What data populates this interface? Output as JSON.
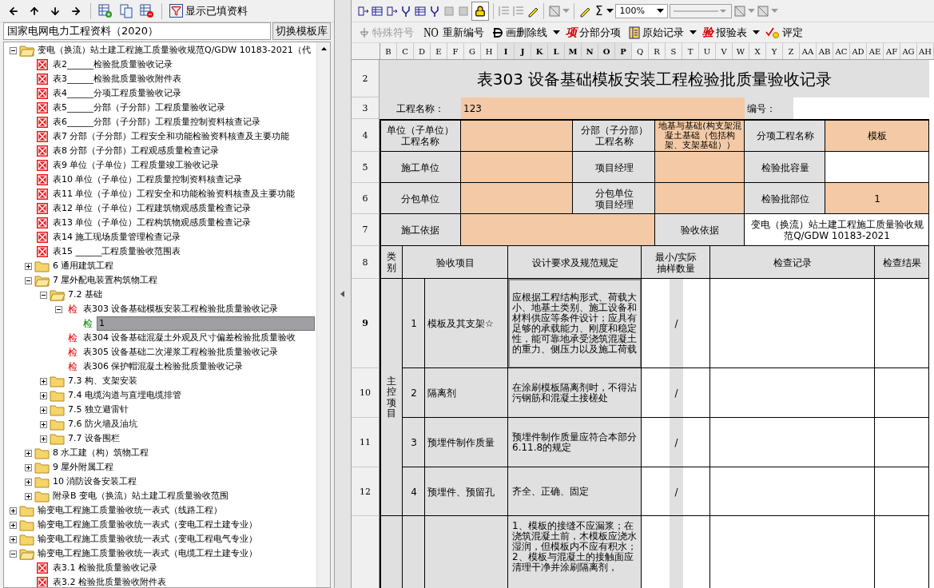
{
  "left_toolbar": {
    "filter_button": "显示已填资料"
  },
  "template": {
    "value": "国家电网电力工程资料（2020）",
    "switch_button": "切换模板库"
  },
  "tree": [
    {
      "kind": "folder",
      "label": "变电（换流）站土建工程施工质量验收规范Q/GDW 10183-2021（代",
      "expanded": true,
      "children": [
        {
          "kind": "form",
          "label": "表2______检验批质量验收记录"
        },
        {
          "kind": "form",
          "label": "表3______检验批质量验收附件表"
        },
        {
          "kind": "form",
          "label": "表4______分项工程质量验收记录"
        },
        {
          "kind": "form",
          "label": "表5______分部（子分部）工程质量验收记录"
        },
        {
          "kind": "form",
          "label": "表6______分部（子分部）工程质量控制资料核查记录"
        },
        {
          "kind": "form",
          "label": "表7 分部（子分部）工程安全和功能检验资料核查及主要功能"
        },
        {
          "kind": "form",
          "label": "表8 分部（子分部）工程观感质量检查记录"
        },
        {
          "kind": "form",
          "label": "表9 单位（子单位）工程质量竣工验收记录"
        },
        {
          "kind": "form",
          "label": "表10 单位（子单位）工程质量控制资料核查记录"
        },
        {
          "kind": "form",
          "label": "表11 单位（子单位）工程安全和功能检验资料核查及主要功能"
        },
        {
          "kind": "form",
          "label": "表12 单位（子单位）工程建筑物观感质量检查记录"
        },
        {
          "kind": "form",
          "label": "表13 单位（子单位）工程构筑物观感质量检查记录"
        },
        {
          "kind": "form",
          "label": "表14 施工现场质量管理检查记录"
        },
        {
          "kind": "form",
          "label": "表15 ______工程质量验收范围表"
        },
        {
          "kind": "folder",
          "label": "6 通用建筑工程",
          "expanded": false
        },
        {
          "kind": "folder",
          "label": "7 屋外配电装置构筑物工程",
          "expanded": true,
          "children": [
            {
              "kind": "folder",
              "label": "7.2 基础",
              "expanded": true,
              "children": [
                {
                  "kind": "check",
                  "mark": "检",
                  "color": "#e00000",
                  "label": "表303 设备基础模板安装工程检验批质量验收记录",
                  "expanded": true,
                  "children": [
                    {
                      "kind": "check",
                      "mark": "检",
                      "color": "#008000",
                      "label": "1",
                      "selected": true
                    }
                  ]
                },
                {
                  "kind": "check",
                  "mark": "检",
                  "color": "#e00000",
                  "label": "表304 设备基础混凝土外观及尺寸偏差检验批质量验收"
                },
                {
                  "kind": "check",
                  "mark": "检",
                  "color": "#e00000",
                  "label": "表305 设备基础二次灌浆工程检验批质量验收记录"
                },
                {
                  "kind": "check",
                  "mark": "检",
                  "color": "#e00000",
                  "label": "表306 保护帽混凝土检验批质量验收记录"
                }
              ]
            },
            {
              "kind": "folder",
              "label": "7.3 构、支架安装",
              "expanded": false
            },
            {
              "kind": "folder",
              "label": "7.4 电缆沟道与直埋电缆排管",
              "expanded": false
            },
            {
              "kind": "folder",
              "label": "7.5 独立避雷针",
              "expanded": false
            },
            {
              "kind": "folder",
              "label": "7.6 防火墙及油坑",
              "expanded": false
            },
            {
              "kind": "folder",
              "label": "7.7 设备围栏",
              "expanded": false
            }
          ]
        },
        {
          "kind": "folder",
          "label": "8 水工建（构）筑物工程",
          "expanded": false
        },
        {
          "kind": "folder",
          "label": "9 屋外附属工程",
          "expanded": false
        },
        {
          "kind": "folder",
          "label": "10 消防设备安装工程",
          "expanded": false
        },
        {
          "kind": "folder",
          "label": "附录B 变电（换流）站土建工程质量验收范围",
          "expanded": false
        }
      ]
    },
    {
      "kind": "folder",
      "label": "输变电工程施工质量验收统一表式（线路工程）",
      "expanded": false
    },
    {
      "kind": "folder",
      "label": "输变电工程施工质量验收统一表式（变电工程土建专业）",
      "expanded": false
    },
    {
      "kind": "folder",
      "label": "输变电工程施工质量验收统一表式（变电工程电气专业）",
      "expanded": false
    },
    {
      "kind": "folder",
      "label": "输变电工程施工质量验收统一表式（电缆工程土建专业）",
      "expanded": true,
      "children": [
        {
          "kind": "form",
          "label": "表3.1 检验批质量验收记录"
        },
        {
          "kind": "form",
          "label": "表3.2 检验批质量验收附件表"
        }
      ]
    }
  ],
  "format_toolbar": {
    "sum_symbol": "Σ",
    "zoom": "100%"
  },
  "edit_toolbar": [
    {
      "kind": "symbol",
      "label": "特殊符号",
      "disabled": true,
      "has_menu": false
    },
    {
      "kind": "glyph",
      "icon_text": "NO",
      "label": "重新编号",
      "disabled": false,
      "has_menu": false
    },
    {
      "kind": "strike",
      "label": "画删除线",
      "disabled": false,
      "has_menu": true
    },
    {
      "kind": "glyph_red",
      "icon_text": "项",
      "label": "分部分项",
      "disabled": false,
      "has_menu": false
    },
    {
      "kind": "book",
      "label": "原始记录",
      "disabled": false,
      "has_menu": true
    },
    {
      "kind": "glyph_red",
      "icon_text": "验",
      "label": "报验表",
      "disabled": false,
      "has_menu": true
    },
    {
      "kind": "tick",
      "label": "评定",
      "disabled": false,
      "has_menu": false
    }
  ],
  "column_headers": [
    {
      "label": "B",
      "selected": false
    },
    {
      "label": "C",
      "selected": false
    },
    {
      "label": "D",
      "selected": false
    },
    {
      "label": "E",
      "selected": false
    },
    {
      "label": "F",
      "selected": false
    },
    {
      "label": "G",
      "selected": false
    },
    {
      "label": "H",
      "selected": false
    },
    {
      "label": "I",
      "selected": true
    },
    {
      "label": "J",
      "selected": true
    },
    {
      "label": "K",
      "selected": true
    },
    {
      "label": "L",
      "selected": true
    },
    {
      "label": "M",
      "selected": true
    },
    {
      "label": "N",
      "selected": true
    },
    {
      "label": "O",
      "selected": true
    },
    {
      "label": "P",
      "selected": true
    },
    {
      "label": "Q",
      "selected": false
    },
    {
      "label": "R",
      "selected": false
    },
    {
      "label": "S",
      "selected": false
    },
    {
      "label": "T",
      "selected": false
    },
    {
      "label": "U",
      "selected": false
    },
    {
      "label": "V",
      "selected": false
    },
    {
      "label": "W",
      "selected": false
    },
    {
      "label": "X",
      "selected": false
    },
    {
      "label": "Y",
      "selected": false
    },
    {
      "label": "Z",
      "selected": false
    },
    {
      "label": "AA",
      "selected": false
    },
    {
      "label": "AB",
      "selected": false
    },
    {
      "label": "AC",
      "selected": false
    },
    {
      "label": "AD",
      "selected": false
    },
    {
      "label": "AE",
      "selected": false
    },
    {
      "label": "AF",
      "selected": false
    },
    {
      "label": "AG",
      "selected": false
    },
    {
      "label": "AH",
      "selected": false
    }
  ],
  "row_headers": [
    {
      "label": "2",
      "selected": false
    },
    {
      "label": "3",
      "selected": false
    },
    {
      "label": "4",
      "selected": false
    },
    {
      "label": "5",
      "selected": false
    },
    {
      "label": "6",
      "selected": false
    },
    {
      "label": "7",
      "selected": false
    },
    {
      "label": "8",
      "selected": false
    },
    {
      "label": "9",
      "selected": true
    },
    {
      "label": "10",
      "selected": false
    },
    {
      "label": "11",
      "selected": false
    },
    {
      "label": "12",
      "selected": false
    }
  ],
  "form": {
    "title": "表303 设备基础模板安装工程检验批质量验收记录",
    "project_label": "工程名称：",
    "project_value": "123",
    "code_label": "编号：",
    "info_rows": [
      [
        {
          "lines": [
            "单位（子单位）",
            "工程名称"
          ],
          "kind": "label"
        },
        {
          "kind": "input"
        },
        {
          "lines": [
            "分部（子分部）",
            "工程名称"
          ],
          "kind": "label"
        },
        {
          "text": "地基与基础(构支架混凝土基础（包括构架、支架基础））",
          "kind": "input"
        },
        {
          "text": "分项工程名称",
          "kind": "label"
        },
        {
          "text": "模板",
          "kind": "input"
        }
      ],
      [
        {
          "text": "施工单位",
          "kind": "label"
        },
        {
          "kind": "input"
        },
        {
          "text": "项目经理",
          "kind": "label"
        },
        {
          "kind": "input"
        },
        {
          "text": "检验批容量",
          "kind": "label"
        },
        {
          "kind": "blank"
        }
      ],
      [
        {
          "text": "分包单位",
          "kind": "label"
        },
        {
          "kind": "input"
        },
        {
          "lines": [
            "分包单位",
            "项目经理"
          ],
          "kind": "label"
        },
        {
          "kind": "input"
        },
        {
          "text": "检验批部位",
          "kind": "label"
        },
        {
          "text": "1",
          "kind": "input"
        }
      ],
      [
        {
          "text": "施工依据",
          "kind": "label"
        },
        {
          "kind": "input"
        },
        {
          "text": "验收依据",
          "kind": "label"
        },
        {
          "text": "变电（换流）站土建工程施工质量验收规范Q/GDW 10183-2021",
          "kind": "blank"
        }
      ]
    ],
    "header": [
      "类别",
      "验收项目",
      "设计要求及规范规定",
      [
        "最小/实际",
        "抽样数量"
      ],
      "检查记录",
      "检查结果"
    ],
    "groups": [
      {
        "category": "主控项目",
        "items": [
          {
            "number": "1",
            "name": "模板及其支架☆",
            "requirement": "应根据工程结构形式、荷载大小、地基土类别、施工设备和材料供应等条件设计；应具有足够的承载能力、刚度和稳定性，能可靠地承受浇筑混凝土的重力、侧压力以及施工荷载",
            "sample": "/",
            "selected": true
          },
          {
            "number": "2",
            "name": "隔离剂",
            "requirement": "在涂刷模板隔离剂时，不得沾污钢筋和混凝土接槎处",
            "sample": "/",
            "selected": false
          },
          {
            "number": "3",
            "name": "预埋件制作质量",
            "requirement": "预埋件制作质量应符合本部分6.11.8的规定",
            "sample": "/",
            "selected": false
          },
          {
            "number": "4",
            "name": "预埋件、预留孔",
            "requirement": "齐全、正确、固定",
            "sample": "/",
            "selected": false
          }
        ]
      },
      {
        "items": [
          {
            "requirement": "1、模板的接缝不应漏浆；在浇筑混凝土前，木模板应浇水湿润，但模板内不应有积水；2、模板与混凝土的接触面应清理干净并涂刷隔离剂，",
            "selected": false
          }
        ]
      }
    ]
  }
}
